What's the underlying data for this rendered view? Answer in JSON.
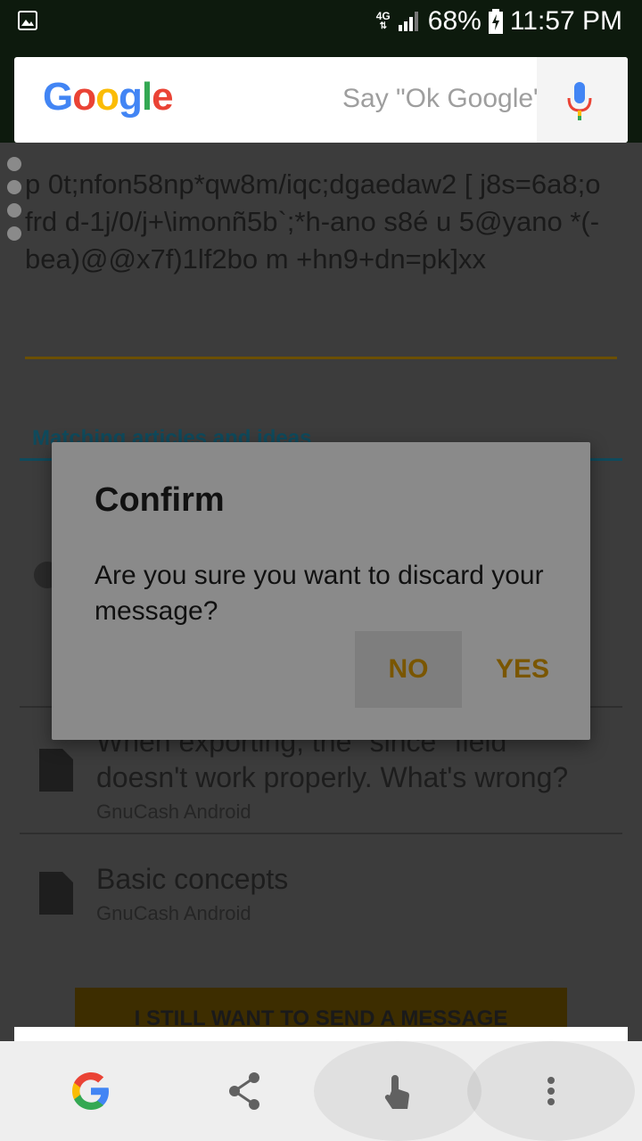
{
  "status_bar": {
    "network": "4G",
    "battery": "68%",
    "time": "11:57 PM"
  },
  "search": {
    "logo": "Google",
    "hint": "Say \"Ok Google\"",
    "mic_icon": "mic-icon"
  },
  "message": {
    "text": "p 0t;nfon58np*qw8m/iqc;dgaedaw2 [ j8s=6a8;o frd d-1j/0/j+\\imonñ5b`;*h-ano s8é u 5@yano *(-bea)@@x7f)1lf2bo m +hn9+dn=pk]xx"
  },
  "section": {
    "title": "Matching articles and ideas"
  },
  "articles": [
    {
      "title_line1": "When exporting, the \"since\" field",
      "title_line2": "doesn't work properly. What's wrong?",
      "source": "GnuCash Android"
    },
    {
      "title_line1": "Basic concepts",
      "source": "GnuCash Android"
    }
  ],
  "cta": {
    "label": "I STILL WANT TO SEND A MESSAGE"
  },
  "dialog": {
    "title": "Confirm",
    "message": "Are you sure you want to discard your message?",
    "no_label": "NO",
    "yes_label": "YES"
  },
  "bottom_bar": {
    "icons": [
      "google-g-icon",
      "share-icon",
      "touch-icon",
      "more-vert-icon"
    ]
  },
  "colors": {
    "accent": "#f0a800",
    "google_blue": "#4285F4",
    "google_red": "#EA4335",
    "google_yellow": "#FBBC05",
    "google_green": "#34A853"
  }
}
